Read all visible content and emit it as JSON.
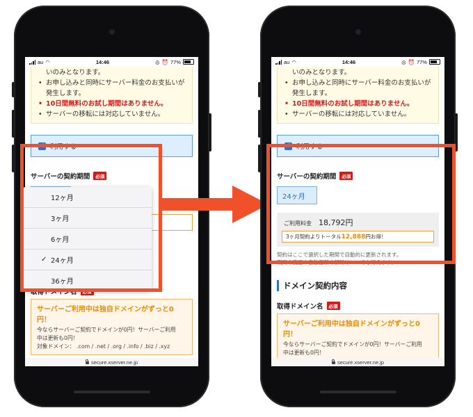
{
  "status": {
    "carrier": "au",
    "time": "14:46",
    "battery": "77%"
  },
  "notice": {
    "top": "いのみとなります。",
    "items": [
      "お申し込みと同時にサーバー料金のお支払いが発生します。",
      "10日間無料のお試し期間はありません。",
      "サーバーの移転には対応していません。"
    ]
  },
  "agree_label": "利用する",
  "contract": {
    "label": "サーバーの契約期間",
    "required": "必須",
    "selected": "24ヶ月",
    "options": [
      "12ヶ月",
      "3ヶ月",
      "6ヶ月",
      "24ヶ月",
      "36ヶ月"
    ],
    "checkmark": "✓",
    "fee_label": "ご利用料金",
    "fee_value": "18,792円",
    "deal_prefix": "3ヶ月契約よりトータル",
    "deal_amount": "12,888",
    "deal_suffix": "円お得！",
    "note_line1": "契約はここで選択した期間で自動的に更新されます。",
    "note_line2": "期間の変更や自動更新の解除はいつでも行えます。"
  },
  "domain": {
    "section_title": "ドメイン契約内容",
    "label": "取得ドメイン名",
    "required": "必須",
    "headline": "サーバーご利用中は独自ドメインがずっと0円！",
    "line1": "今ならサーバーご契約でドメインが0円！サーバーご利用",
    "line2": "中は更新も0円！",
    "line3": "対象ドメイン： .com / .net / .org / .info / .biz / .xyz"
  },
  "url": "secure.xserver.ne.jp",
  "colors": {
    "highlight": "#f0502a",
    "accent": "#2f6fce",
    "required": "#d21a1a",
    "orange": "#f08a00"
  }
}
